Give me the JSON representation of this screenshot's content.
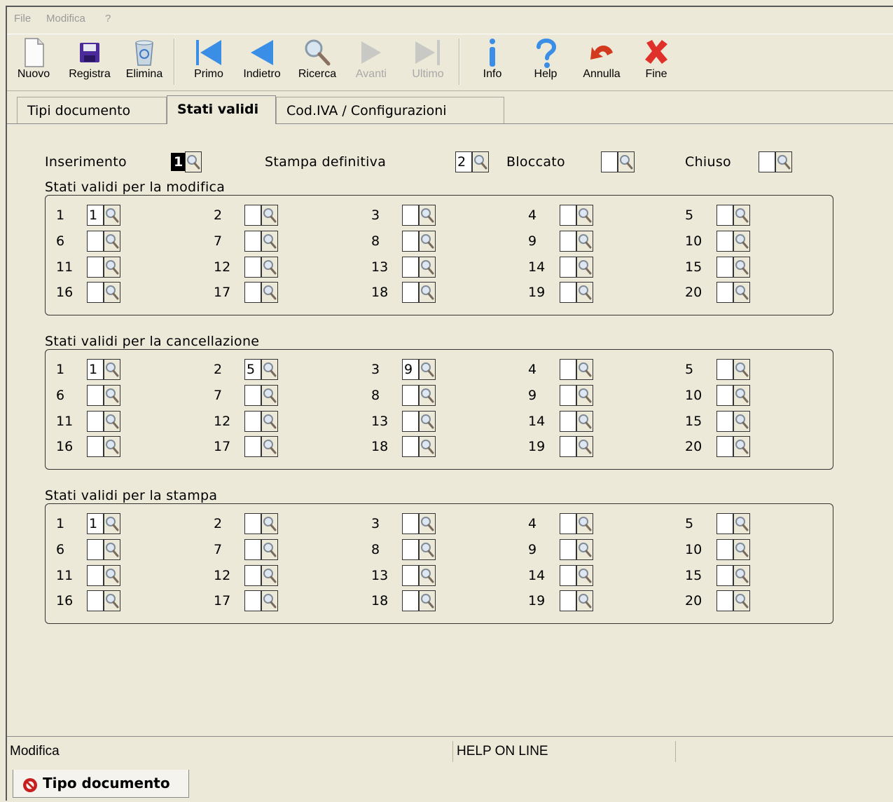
{
  "menu": [
    "File",
    "Modifica",
    "?"
  ],
  "toolbar": [
    {
      "label": "Nuovo",
      "icon": "new-document-icon",
      "enabled": true
    },
    {
      "label": "Registra",
      "icon": "save-disk-icon",
      "enabled": true
    },
    {
      "label": "Elimina",
      "icon": "recycle-bin-icon",
      "enabled": true
    },
    {
      "label": "Primo",
      "icon": "first-record-icon",
      "enabled": true
    },
    {
      "label": "Indietro",
      "icon": "previous-record-icon",
      "enabled": true
    },
    {
      "label": "Ricerca",
      "icon": "magnifier-icon",
      "enabled": true
    },
    {
      "label": "Avanti",
      "icon": "next-record-icon",
      "enabled": false
    },
    {
      "label": "Ultimo",
      "icon": "last-record-icon",
      "enabled": false
    },
    {
      "label": "Info",
      "icon": "info-icon",
      "enabled": true
    },
    {
      "label": "Help",
      "icon": "help-icon",
      "enabled": true
    },
    {
      "label": "Annulla",
      "icon": "undo-arrow-icon",
      "enabled": true
    },
    {
      "label": "Fine",
      "icon": "close-x-icon",
      "enabled": true
    }
  ],
  "tabs": [
    {
      "label": "Tipi documento",
      "active": false
    },
    {
      "label": "Stati validi",
      "active": true
    },
    {
      "label": "Cod.IVA / Configurazioni",
      "active": false
    }
  ],
  "top_fields": [
    {
      "label": "Inserimento",
      "value": "1",
      "selected": true
    },
    {
      "label": "Stampa definitiva",
      "value": "2",
      "selected": false
    },
    {
      "label": "Bloccato",
      "value": "",
      "selected": false
    },
    {
      "label": "Chiuso",
      "value": "",
      "selected": false
    }
  ],
  "groups": [
    {
      "title": "Stati validi per la modifica",
      "values": [
        "1",
        "",
        "",
        "",
        "",
        "",
        "",
        "",
        "",
        "",
        "",
        "",
        "",
        "",
        "",
        "",
        "",
        "",
        "",
        ""
      ]
    },
    {
      "title": "Stati validi per la cancellazione",
      "values": [
        "1",
        "5",
        "9",
        "",
        "",
        "",
        "",
        "",
        "",
        "",
        "",
        "",
        "",
        "",
        "",
        "",
        "",
        "",
        "",
        ""
      ]
    },
    {
      "title": "Stati validi per la stampa",
      "values": [
        "1",
        "",
        "",
        "",
        "",
        "",
        "",
        "",
        "",
        "",
        "",
        "",
        "",
        "",
        "",
        "",
        "",
        "",
        "",
        ""
      ]
    }
  ],
  "numbers": [
    "1",
    "2",
    "3",
    "4",
    "5",
    "6",
    "7",
    "8",
    "9",
    "10",
    "11",
    "12",
    "13",
    "14",
    "15",
    "16",
    "17",
    "18",
    "19",
    "20"
  ],
  "status": {
    "mode": "Modifica",
    "help": "HELP ON LINE"
  },
  "task": {
    "label": "Tipo documento"
  },
  "colors": {
    "background": "#ece9d8",
    "selected_field": "#000000",
    "fine_red": "#e0302a",
    "nav_blue": "#3a8ee6"
  }
}
